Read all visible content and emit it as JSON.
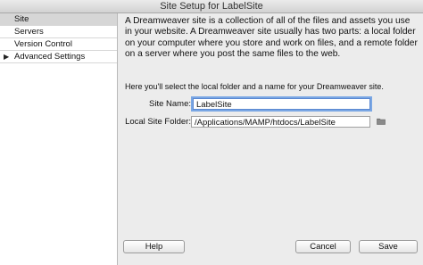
{
  "window": {
    "title": "Site Setup for LabelSite"
  },
  "sidebar": {
    "items": [
      {
        "label": "Site"
      },
      {
        "label": "Servers"
      },
      {
        "label": "Version Control"
      },
      {
        "label": "Advanced Settings"
      }
    ]
  },
  "main": {
    "intro": "A Dreamweaver site is a collection of all of the files and assets you use in your website. A Dreamweaver site usually has two parts: a local folder on your computer where you store and work on files, and a remote folder on a server where you post the same files to the web.",
    "prompt": "Here you'll select the local folder and a name for your Dreamweaver site.",
    "site_name_label": "Site Name:",
    "site_name_value": "LabelSite",
    "local_folder_label": "Local Site Folder:",
    "local_folder_value": "/Applications/MAMP/htdocs/LabelSite"
  },
  "footer": {
    "help_label": "Help",
    "cancel_label": "Cancel",
    "save_label": "Save"
  },
  "icons": {
    "expand_arrow": "▶",
    "folder": "folder-icon"
  },
  "colors": {
    "focus_ring": "#7aa7e4",
    "selected_row": "#d6d6d6"
  }
}
